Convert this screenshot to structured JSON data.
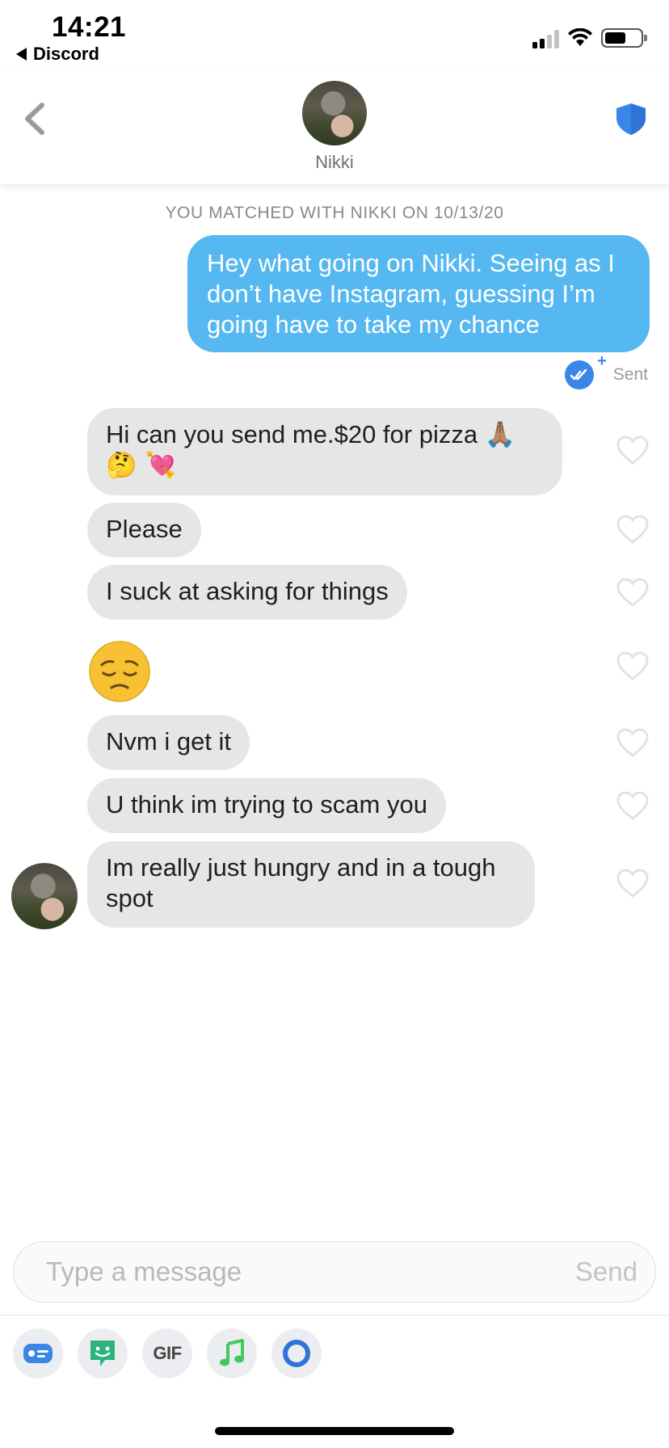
{
  "status_bar": {
    "time": "14:21",
    "back_app": "Discord"
  },
  "header": {
    "match_name": "Nikki",
    "avatar_icon": "profile-photo",
    "safety_icon": "shield-icon",
    "back_icon": "chevron-left-icon"
  },
  "match_note": "YOU MATCHED WITH NIKKI ON 10/13/20",
  "messages": {
    "outgoing": [
      {
        "line1": "Hey what going on Nikki. Seeing as I",
        "line2": "don’t have Instagram, guessing I’m",
        "line3": "going have to take my chance"
      }
    ],
    "sent_status": "Sent",
    "incoming": [
      {
        "line1": "Hi can you send me.$20 for pizza 🙏🏽",
        "line2": "🤔 💘"
      },
      {
        "text": "Please"
      },
      {
        "text": "I suck at asking for things"
      },
      {
        "emoji": "😔"
      },
      {
        "text": "Nvm i get it"
      },
      {
        "text": "U think im trying to scam you"
      },
      {
        "line1": "Im really just hungry and in a tough",
        "line2": "spot"
      }
    ]
  },
  "composer": {
    "placeholder": "Type a message",
    "send_label": "Send"
  },
  "toolbar": {
    "items": [
      "contact-card-icon",
      "sticker-icon",
      "GIF",
      "music-note-icon",
      "loop-icon"
    ],
    "gif_label": "GIF"
  },
  "colors": {
    "outgoing_bubble": "#56b8f0",
    "incoming_bubble": "#e6e6e6",
    "accent_blue": "#3a86e8"
  }
}
